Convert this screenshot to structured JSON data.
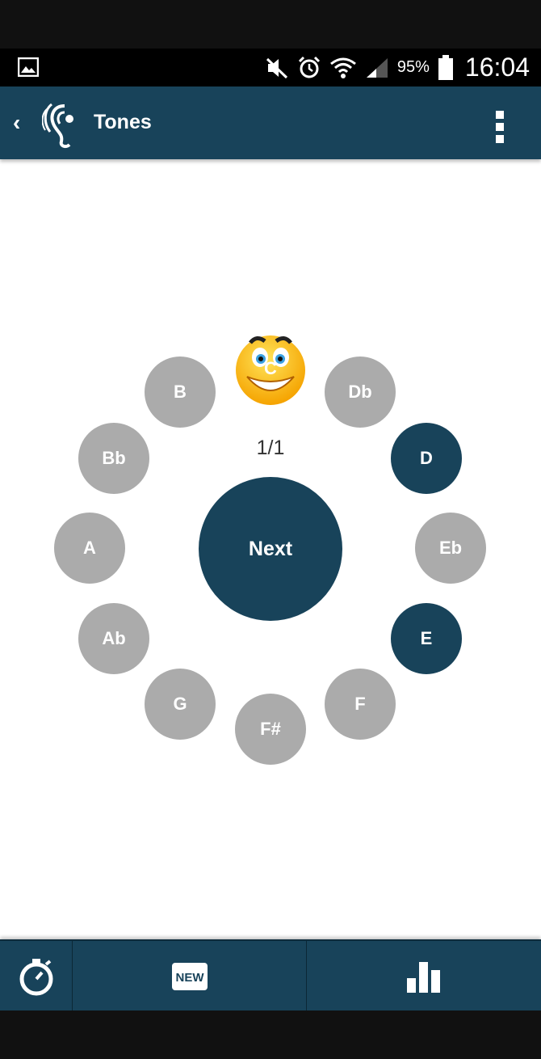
{
  "status": {
    "battery": "95%",
    "time": "16:04"
  },
  "app": {
    "title": "Tones",
    "back_label": "‹"
  },
  "progress": "1/1",
  "current_note": "C",
  "next_label": "Next",
  "notes": [
    {
      "label": "B",
      "active": false
    },
    {
      "label": "Db",
      "active": false
    },
    {
      "label": "Bb",
      "active": false
    },
    {
      "label": "D",
      "active": true
    },
    {
      "label": "A",
      "active": false
    },
    {
      "label": "Eb",
      "active": false
    },
    {
      "label": "Ab",
      "active": false
    },
    {
      "label": "E",
      "active": true
    },
    {
      "label": "G",
      "active": false
    },
    {
      "label": "F",
      "active": false
    },
    {
      "label": "F#",
      "active": false
    }
  ],
  "bottom_nav": {
    "new_badge": "NEW"
  },
  "colors": {
    "primary": "#18435a",
    "inactive_note": "#ababab"
  },
  "icons": [
    "gallery-icon",
    "mute-icon",
    "alarm-icon",
    "wifi-icon",
    "signal-icon",
    "battery-icon",
    "ear-logo-icon",
    "overflow-menu-icon",
    "stopwatch-icon",
    "new-badge-icon",
    "bar-chart-icon"
  ]
}
